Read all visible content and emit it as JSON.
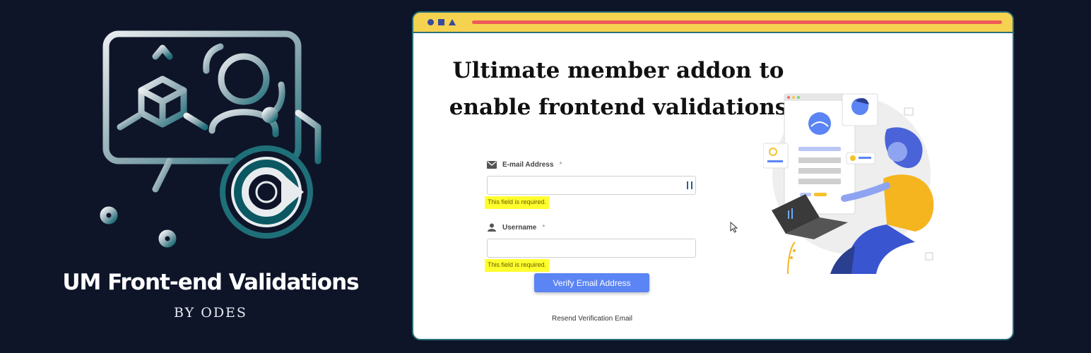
{
  "brand": {
    "title": "UM Front-end Validations",
    "subtitle": "BY ODES"
  },
  "browser": {
    "headline_line1": "Ultimate member addon to",
    "headline_line2": "enable frontend validations"
  },
  "form": {
    "email": {
      "label": "E-mail Address",
      "required_mark": "*",
      "value": "",
      "error": "This field is required."
    },
    "username": {
      "label": "Username",
      "required_mark": "*",
      "value": "",
      "error": "This field is required."
    },
    "verify_button": "Verify Email Address",
    "resend_link": "Resend Verification Email"
  },
  "colors": {
    "background": "#0e1529",
    "browser_bar": "#f5d250",
    "url_bar": "#ef5a5a",
    "button": "#5b84f4",
    "error_highlight": "#ffff2e",
    "logo_teal": "#2b6f7a"
  }
}
